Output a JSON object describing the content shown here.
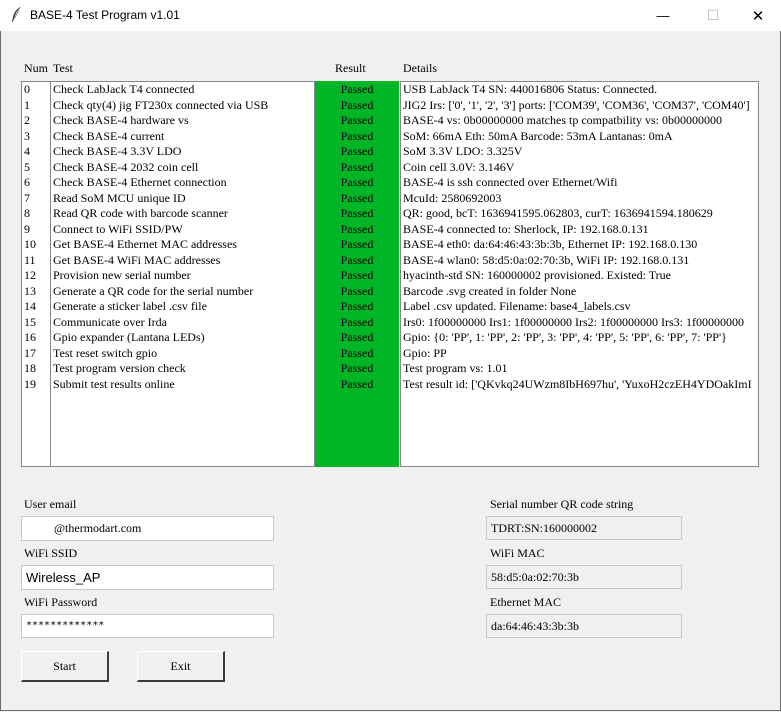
{
  "window": {
    "title": "BASE-4 Test Program v1.01",
    "minimize_glyph": "—",
    "maximize_glyph": "☐",
    "close_glyph": "✕"
  },
  "columns": {
    "num": "Num",
    "test": "Test",
    "result": "Result",
    "details": "Details"
  },
  "tests": [
    {
      "num": "0",
      "test": "Check LabJack T4 connected",
      "result": "Passed",
      "details": "USB LabJack T4 SN: 440016806 Status: Connected."
    },
    {
      "num": "1",
      "test": "Check qty(4) jig FT230x connected via USB",
      "result": "Passed",
      "details": "JIG2 Irs: ['0', '1', '2', '3'] ports: ['COM39', 'COM36', 'COM37', 'COM40']"
    },
    {
      "num": "2",
      "test": "Check BASE-4 hardware vs",
      "result": "Passed",
      "details": "BASE-4 vs: 0b00000000 matches tp compatbility vs: 0b00000000"
    },
    {
      "num": "3",
      "test": "Check BASE-4 current",
      "result": "Passed",
      "details": "SoM: 66mA Eth: 50mA Barcode: 53mA Lantanas: 0mA"
    },
    {
      "num": "4",
      "test": "Check BASE-4 3.3V LDO",
      "result": "Passed",
      "details": "SoM 3.3V LDO: 3.325V"
    },
    {
      "num": "5",
      "test": "Check BASE-4 2032 coin cell",
      "result": "Passed",
      "details": "Coin cell 3.0V: 3.146V"
    },
    {
      "num": "6",
      "test": "Check BASE-4 Ethernet connection",
      "result": "Passed",
      "details": "BASE-4 is ssh connected over Ethernet/Wifi"
    },
    {
      "num": "7",
      "test": "Read SoM MCU unique ID",
      "result": "Passed",
      "details": "McuId: 2580692003"
    },
    {
      "num": "8",
      "test": "Read QR code with barcode scanner",
      "result": "Passed",
      "details": "QR: good, bcT: 1636941595.062803, curT: 1636941594.180629"
    },
    {
      "num": "9",
      "test": "Connect to WiFi SSID/PW",
      "result": "Passed",
      "details": "BASE-4 connected to: Sherlock, IP: 192.168.0.131"
    },
    {
      "num": "10",
      "test": "Get BASE-4 Ethernet MAC addresses",
      "result": "Passed",
      "details": "BASE-4 eth0: da:64:46:43:3b:3b, Ethernet IP: 192.168.0.130"
    },
    {
      "num": "11",
      "test": "Get BASE-4 WiFi MAC addresses",
      "result": "Passed",
      "details": "BASE-4 wlan0: 58:d5:0a:02:70:3b, WiFi IP: 192.168.0.131"
    },
    {
      "num": "12",
      "test": "Provision new serial number",
      "result": "Passed",
      "details": "hyacinth-std SN: 160000002 provisioned.  Existed: True"
    },
    {
      "num": "13",
      "test": "Generate a QR code for the serial number",
      "result": "Passed",
      "details": "Barcode .svg created in folder None"
    },
    {
      "num": "14",
      "test": "Generate a sticker label .csv file",
      "result": "Passed",
      "details": "Label .csv updated. Filename: base4_labels.csv"
    },
    {
      "num": "15",
      "test": "Communicate over Irda",
      "result": "Passed",
      "details": "Irs0: 1f00000000 Irs1: 1f00000000 Irs2: 1f00000000 Irs3: 1f00000000"
    },
    {
      "num": "16",
      "test": "Gpio expander (Lantana LEDs)",
      "result": "Passed",
      "details": "Gpio: {0: 'PP', 1: 'PP', 2: 'PP', 3: 'PP', 4: 'PP', 5: 'PP', 6: 'PP', 7: 'PP'}"
    },
    {
      "num": "17",
      "test": "Test reset switch gpio",
      "result": "Passed",
      "details": "Gpio: PP"
    },
    {
      "num": "18",
      "test": "Test program version check",
      "result": "Passed",
      "details": "Test program vs: 1.01"
    },
    {
      "num": "19",
      "test": "Submit test results online",
      "result": "Passed",
      "details": "Test result id: ['QKvkq24UWzm8IbH697hu', 'YuxoH2czEH4YDOakImI"
    }
  ],
  "form": {
    "user_email_label": "User email",
    "user_email_value": "@thermodart.com",
    "wifi_ssid_label": "WiFi SSID",
    "wifi_ssid_value": "Wireless_AP",
    "wifi_password_label": "WiFi Password",
    "wifi_password_value": "*************"
  },
  "info": {
    "serial_qr_label": "Serial number QR code string",
    "serial_qr_value": "TDRT:SN:160000002",
    "wifi_mac_label": "WiFi MAC",
    "wifi_mac_value": "58:d5:0a:02:70:3b",
    "ethernet_mac_label": "Ethernet MAC",
    "ethernet_mac_value": "da:64:46:43:3b:3b"
  },
  "buttons": {
    "start": "Start",
    "exit": "Exit"
  },
  "colors": {
    "pass_green": "#00b526"
  }
}
